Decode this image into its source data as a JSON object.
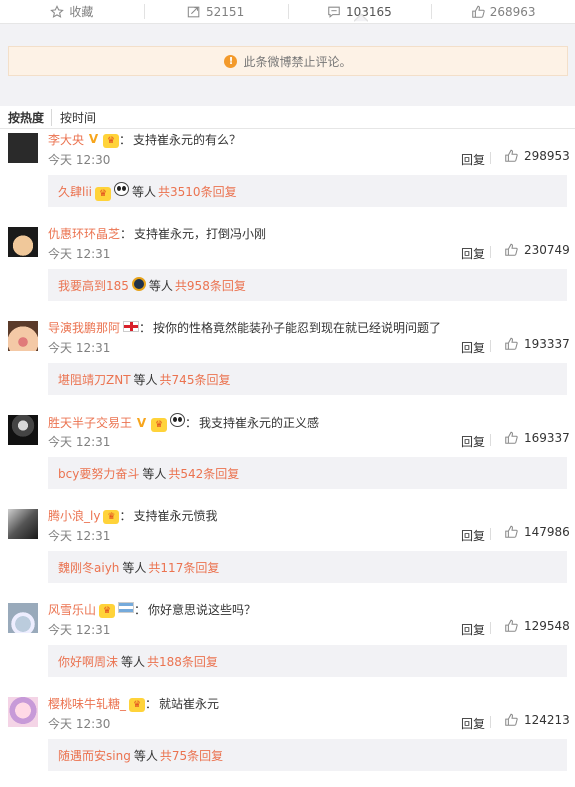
{
  "actions": {
    "favorite": {
      "label": "收藏",
      "icon": "star-icon"
    },
    "repost": {
      "label": "52151",
      "icon": "repost-icon"
    },
    "comment": {
      "label": "103165",
      "icon": "comment-icon"
    },
    "like": {
      "label": "268963",
      "icon": "thumbs-up-icon"
    }
  },
  "notice": {
    "text": "此条微博禁止评论。"
  },
  "sort": {
    "hot": "按热度",
    "time": "按时间"
  },
  "colors": {
    "accent": "#eb7350",
    "notice_bg": "#fdf2e6",
    "warn": "#f39a2b"
  },
  "reply_label": "回复",
  "comments": [
    {
      "user": "李大央",
      "badges": [
        "vip-v-icon",
        "crown-icon"
      ],
      "text": "支持崔永元的有么？",
      "time": "今天 12:30",
      "likes": "298953",
      "sub": {
        "name": "久肆lii",
        "badges": [
          "crown-icon",
          "panda-icon"
        ],
        "who": "等人",
        "count": "共3510条回复"
      }
    },
    {
      "user": "仇惠环环晶芝",
      "badges": [],
      "text": "支持崔永元，打倒冯小刚",
      "time": "今天 12:31",
      "likes": "230749",
      "sub": {
        "name": "我要高到185",
        "badges": [
          "medal-icon"
        ],
        "who": "等人",
        "count": "共958条回复"
      }
    },
    {
      "user": "导演我鹏那阿",
      "badges": [
        "england-flag-icon"
      ],
      "text": "按你的性格竟然能装孙子能忍到现在就已经说明问题了",
      "time": "今天 12:31",
      "likes": "193337",
      "sub": {
        "name": "堪阻靖刀ZNT",
        "badges": [],
        "who": "等人",
        "count": "共745条回复"
      }
    },
    {
      "user": "胜天半子交易王",
      "badges": [
        "vip-v-icon",
        "crown-icon",
        "panda-icon"
      ],
      "text": "我支持崔永元的正义感",
      "time": "今天 12:31",
      "likes": "169337",
      "sub": {
        "name": "bcy要努力奋斗",
        "badges": [],
        "who": "等人",
        "count": "共542条回复"
      }
    },
    {
      "user": "腾小浪_ly",
      "badges": [
        "crown-icon"
      ],
      "text": "支持崔永元愤我",
      "time": "今天 12:31",
      "likes": "147986",
      "sub": {
        "name": "魏刚冬aiyh",
        "badges": [],
        "who": "等人",
        "count": "共117条回复"
      }
    },
    {
      "user": "风雪乐山",
      "badges": [
        "crown-icon",
        "argentina-flag-icon"
      ],
      "text": "你好意思说这些吗？",
      "time": "今天 12:31",
      "likes": "129548",
      "sub": {
        "name": "你好啊周沫",
        "badges": [],
        "who": "等人",
        "count": "共188条回复"
      }
    },
    {
      "user": "樱桃味牛轧糖_",
      "badges": [
        "crown-icon"
      ],
      "text": "就站崔永元",
      "time": "今天 12:30",
      "likes": "124213",
      "sub": {
        "name": "随遇而安sing",
        "badges": [],
        "who": "等人",
        "count": "共75条回复"
      }
    }
  ]
}
